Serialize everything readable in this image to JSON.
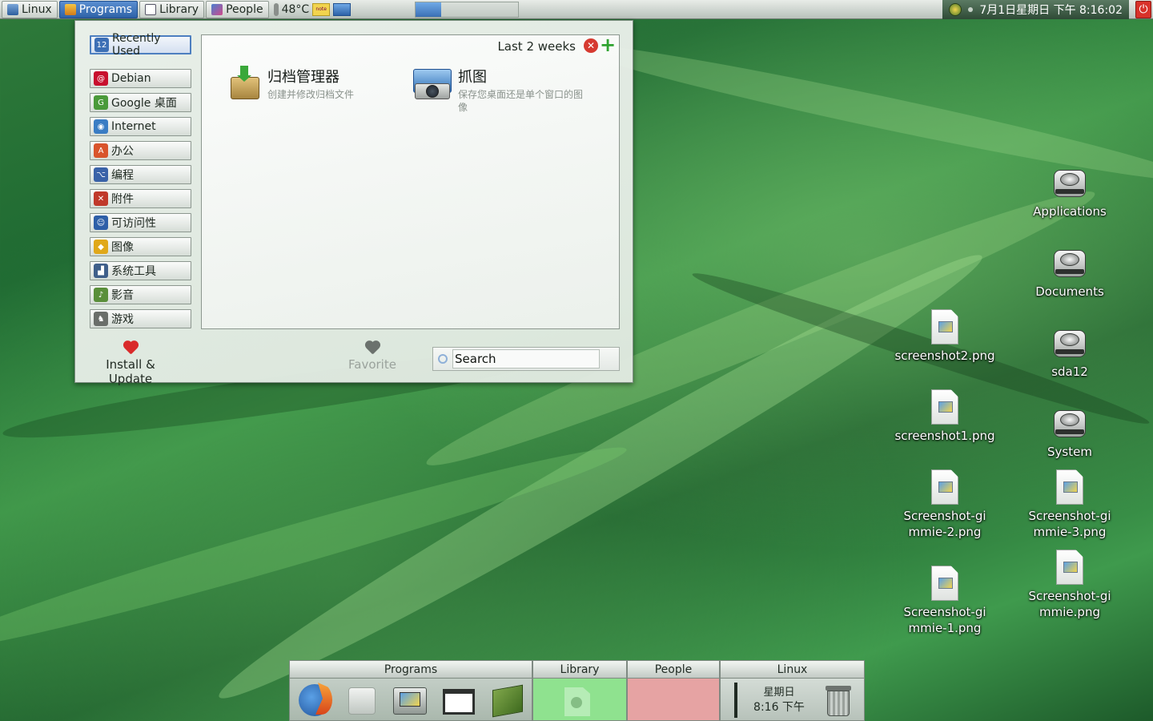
{
  "top_panel": {
    "buttons": [
      {
        "label": "Linux",
        "icon": "linux-icon"
      },
      {
        "label": "Programs",
        "icon": "programs-icon"
      },
      {
        "label": "Library",
        "icon": "library-icon"
      },
      {
        "label": "People",
        "icon": "people-icon"
      }
    ],
    "temperature": "48°C",
    "note_text": "note",
    "clock": "7月1日星期日 下午 8:16:02"
  },
  "menu": {
    "categories": [
      {
        "label": "Recently Used",
        "icon": "calendar-icon",
        "icon_text": "12",
        "color": "#3d6fb5"
      },
      {
        "label": "Debian",
        "icon": "debian-swirl-icon",
        "icon_text": "@",
        "color": "#c8102e"
      },
      {
        "label": "Google 桌面",
        "icon": "google-desktop-icon",
        "icon_text": "G",
        "color": "#4a9a3a"
      },
      {
        "label": "Internet",
        "icon": "globe-icon",
        "icon_text": "◉",
        "color": "#3a7dc4"
      },
      {
        "label": "办公",
        "icon": "office-icon",
        "icon_text": "A",
        "color": "#d9542c"
      },
      {
        "label": "编程",
        "icon": "programming-icon",
        "icon_text": "⌥",
        "color": "#3a62a8"
      },
      {
        "label": "附件",
        "icon": "accessories-icon",
        "icon_text": "✕",
        "color": "#c0392b"
      },
      {
        "label": "可访问性",
        "icon": "accessibility-icon",
        "icon_text": "☺",
        "color": "#2e5fa8"
      },
      {
        "label": "图像",
        "icon": "graphics-icon",
        "icon_text": "◆",
        "color": "#e0a81a"
      },
      {
        "label": "系统工具",
        "icon": "system-tools-icon",
        "icon_text": "▟",
        "color": "#3f5f8a"
      },
      {
        "label": "影音",
        "icon": "multimedia-icon",
        "icon_text": "♪",
        "color": "#5a8f3a"
      },
      {
        "label": "游戏",
        "icon": "games-icon",
        "icon_text": "♞",
        "color": "#6a6e6a"
      }
    ],
    "recent": {
      "period": "Last 2 weeks",
      "apps": [
        {
          "title": "归档管理器",
          "desc": "创建并修改归档文件",
          "icon": "archive-manager-icon"
        },
        {
          "title": "抓图",
          "desc": "保存您桌面还是单个窗口的图像",
          "icon": "screenshot-camera-icon"
        }
      ]
    },
    "bottom": {
      "install_label": "Install & Update",
      "favorite_label": "Favorite"
    },
    "search": {
      "value": "Search",
      "placeholder": "Search"
    }
  },
  "desktop": {
    "drives": [
      {
        "label": "Applications"
      },
      {
        "label": "Documents"
      },
      {
        "label": "sda12"
      },
      {
        "label": "System"
      }
    ],
    "files": [
      {
        "label": "screenshot2.png"
      },
      {
        "label": "screenshot1.png"
      },
      {
        "label": "Screenshot-gimmie-2.png"
      },
      {
        "label": "Screenshot-gimmie-3.png"
      },
      {
        "label": "Screenshot-gimmie-1.png"
      },
      {
        "label": "Screenshot-gimmie.png"
      }
    ]
  },
  "dock": {
    "tabs": [
      "Programs",
      "Library",
      "People",
      "Linux"
    ],
    "launchers": [
      "firefox-icon",
      "printer-icon",
      "image-viewer-icon",
      "window-icon",
      "book-icon"
    ],
    "library_icon": "gnome-foot-icon",
    "day": "星期日",
    "time": "8:16 下午",
    "trash_icon": "trash-icon",
    "colors": {
      "library": "#8fe28f",
      "people": "#e6a3a3"
    }
  }
}
